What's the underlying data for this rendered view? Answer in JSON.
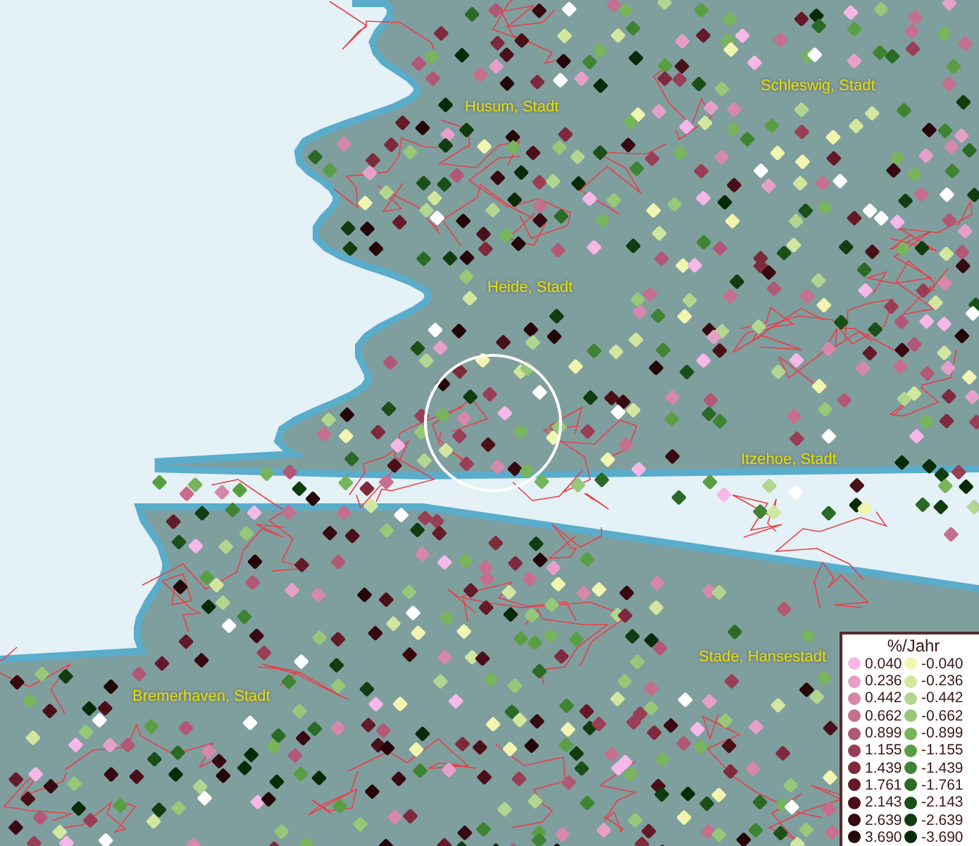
{
  "map": {
    "place_labels": [
      {
        "text": "Husum, Stadt"
      },
      {
        "text": "Schleswig, Stadt"
      },
      {
        "text": "Heide, Stadt"
      },
      {
        "text": "Itzehoe, Stadt"
      },
      {
        "text": "Stade, Hansestadt"
      },
      {
        "text": "Bremerhaven, Stadt"
      }
    ]
  },
  "legend": {
    "title": "%/Jahr",
    "positive": [
      {
        "label": "0.040",
        "color": "#f5b8e8"
      },
      {
        "label": "0.236",
        "color": "#e6a0c8"
      },
      {
        "label": "0.442",
        "color": "#d688aa"
      },
      {
        "label": "0.662",
        "color": "#c66e8e"
      },
      {
        "label": "0.899",
        "color": "#b25876"
      },
      {
        "label": "1.155",
        "color": "#9a3e56"
      },
      {
        "label": "1.439",
        "color": "#7e2a3c"
      },
      {
        "label": "1.761",
        "color": "#641a28"
      },
      {
        "label": "2.143",
        "color": "#4a1018"
      },
      {
        "label": "2.639",
        "color": "#360a10"
      },
      {
        "label": "3.690",
        "color": "#240508"
      }
    ],
    "negative": [
      {
        "label": "-0.040",
        "color": "#f2f5b0"
      },
      {
        "label": "-0.236",
        "color": "#d2e6a0"
      },
      {
        "label": "-0.442",
        "color": "#b2d690"
      },
      {
        "label": "-0.662",
        "color": "#96c878"
      },
      {
        "label": "-0.899",
        "color": "#78b45c"
      },
      {
        "label": "-1.155",
        "color": "#5a9e44"
      },
      {
        "label": "-1.439",
        "color": "#3e8432"
      },
      {
        "label": "-1.761",
        "color": "#2a6a24"
      },
      {
        "label": "-2.143",
        "color": "#1a5018"
      },
      {
        "label": "-2.639",
        "color": "#103c10"
      },
      {
        "label": "-3.690",
        "color": "#082a08"
      }
    ]
  }
}
